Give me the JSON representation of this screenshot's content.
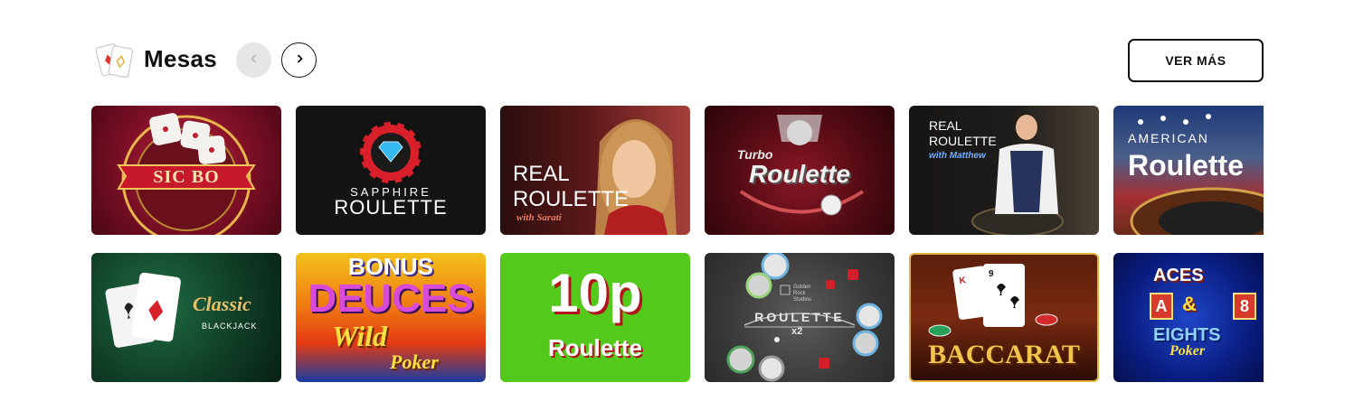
{
  "header": {
    "title": "Mesas",
    "see_more_label": "VER MÁS"
  },
  "colors": {
    "accent": "#111111",
    "nav_disabled_bg": "#e6e6e6"
  },
  "games": [
    {
      "label_lines": [
        "SIC BO"
      ]
    },
    {
      "label_lines": [
        "SAPPHIRE",
        "ROULETTE"
      ]
    },
    {
      "label_lines": [
        "REAL",
        "ROULETTE",
        "with Sarati"
      ]
    },
    {
      "label_lines": [
        "Turbo",
        "Roulette"
      ]
    },
    {
      "label_lines": [
        "REAL",
        "ROULETTE",
        "with Matthew"
      ]
    },
    {
      "label_lines": [
        "AMERICAN",
        "Roulette"
      ]
    },
    {
      "label_lines": [
        "Classic",
        "BLACKJACK"
      ]
    },
    {
      "label_lines": [
        "BONUS",
        "DEUCES",
        "Wild",
        "Poker"
      ]
    },
    {
      "label_lines": [
        "10p",
        "Roulette"
      ]
    },
    {
      "label_lines": [
        "Golden",
        "Rock",
        "Studios",
        "ROULETTE",
        "x2"
      ]
    },
    {
      "label_lines": [
        "BACCARAT"
      ]
    },
    {
      "label_lines": [
        "ACES",
        "A",
        "&",
        "8",
        "EIGHTS",
        "Poker"
      ]
    }
  ]
}
